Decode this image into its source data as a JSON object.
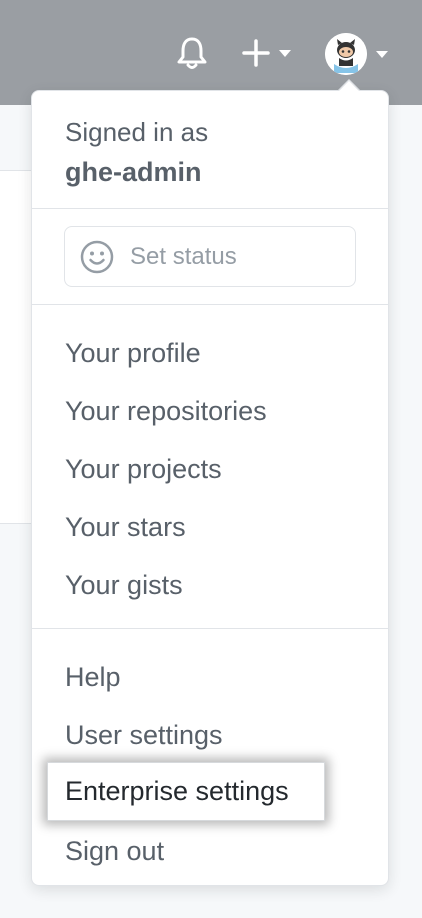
{
  "header": {
    "icons": [
      "bell-icon",
      "plus-icon",
      "avatar-icon"
    ]
  },
  "account": {
    "signed_in_label": "Signed in as",
    "username": "ghe-admin"
  },
  "status": {
    "label": "Set status",
    "icon": "smiley-icon"
  },
  "menu": {
    "profile_items": [
      "Your profile",
      "Your repositories",
      "Your projects",
      "Your stars",
      "Your gists"
    ],
    "settings_items": [
      "Help",
      "User settings",
      "Enterprise settings",
      "Sign out"
    ]
  },
  "colors": {
    "header_bg": "#9a9ea3",
    "menu_text": "#586069",
    "highlight_text": "#24292e",
    "page_bg": "#f6f8fa"
  }
}
